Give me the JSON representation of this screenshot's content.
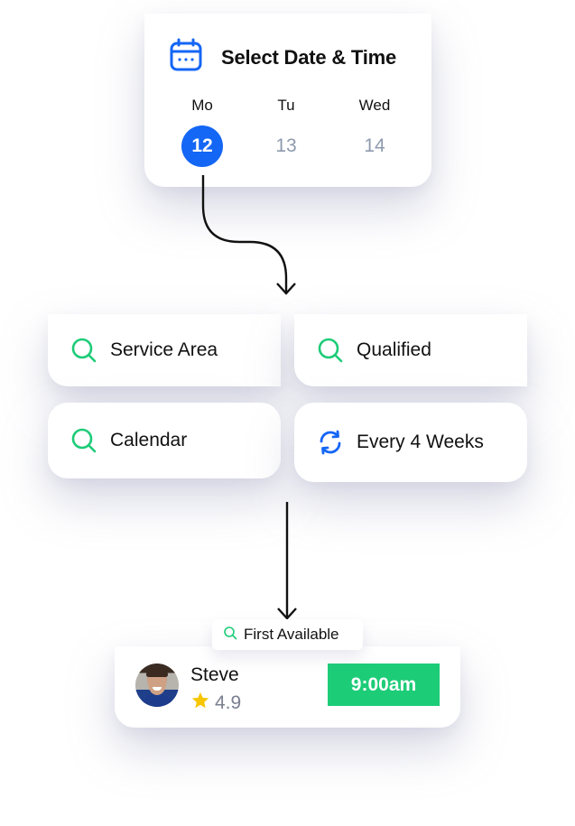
{
  "date_card": {
    "title": "Select Date & Time",
    "icon": "calendar-icon",
    "days": [
      {
        "name": "Mo",
        "number": "12",
        "selected": true
      },
      {
        "name": "Tu",
        "number": "13",
        "selected": false
      },
      {
        "name": "Wed",
        "number": "14",
        "selected": false
      }
    ]
  },
  "filters": [
    {
      "label": "Service Area",
      "icon": "search-icon"
    },
    {
      "label": "Qualified",
      "icon": "search-icon"
    },
    {
      "label": "Calendar",
      "icon": "search-icon"
    },
    {
      "label": "Every 4 Weeks",
      "icon": "refresh-icon"
    }
  ],
  "result": {
    "badge_label": "First Available",
    "badge_icon": "search-icon",
    "provider_name": "Steve",
    "rating": "4.9",
    "rating_icon": "star-icon",
    "time_label": "9:00am"
  },
  "colors": {
    "primary_blue": "#1466f5",
    "accent_green": "#1dcc77",
    "muted_day": "#8e9aae",
    "star_yellow": "#f7c600",
    "rating_gray": "#7a7f90"
  }
}
